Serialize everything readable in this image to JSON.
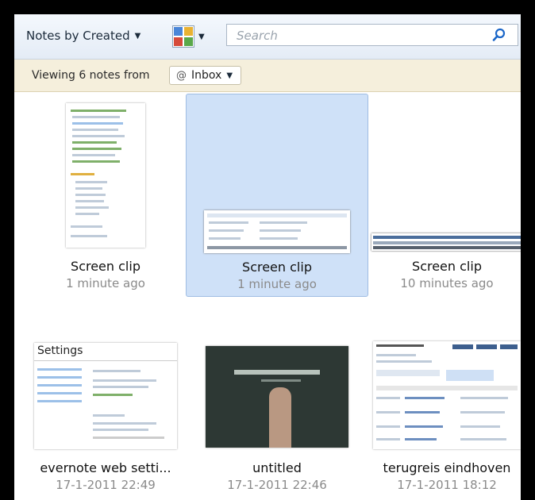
{
  "toolbar": {
    "sort_label": "Notes by Created",
    "search_placeholder": "Search",
    "colors": {
      "accent": "#1a66c8"
    }
  },
  "filter": {
    "prefix": "Viewing 6 notes from",
    "notebook": "Inbox",
    "notebook_icon": "at-icon"
  },
  "notes": [
    {
      "title": "Screen clip",
      "date": "1 minute ago",
      "selected": false
    },
    {
      "title": "Screen clip",
      "date": "1 minute ago",
      "selected": true
    },
    {
      "title": "Screen clip",
      "date": "10 minutes ago",
      "selected": false
    },
    {
      "title": "evernote web setti...",
      "date": "17-1-2011 22:49",
      "selected": false
    },
    {
      "title": "untitled",
      "date": "17-1-2011 22:46",
      "selected": false
    },
    {
      "title": "terugreis eindhoven",
      "date": "17-1-2011 18:12",
      "selected": false
    }
  ],
  "thumbnails": {
    "settings_heading": "Settings"
  }
}
